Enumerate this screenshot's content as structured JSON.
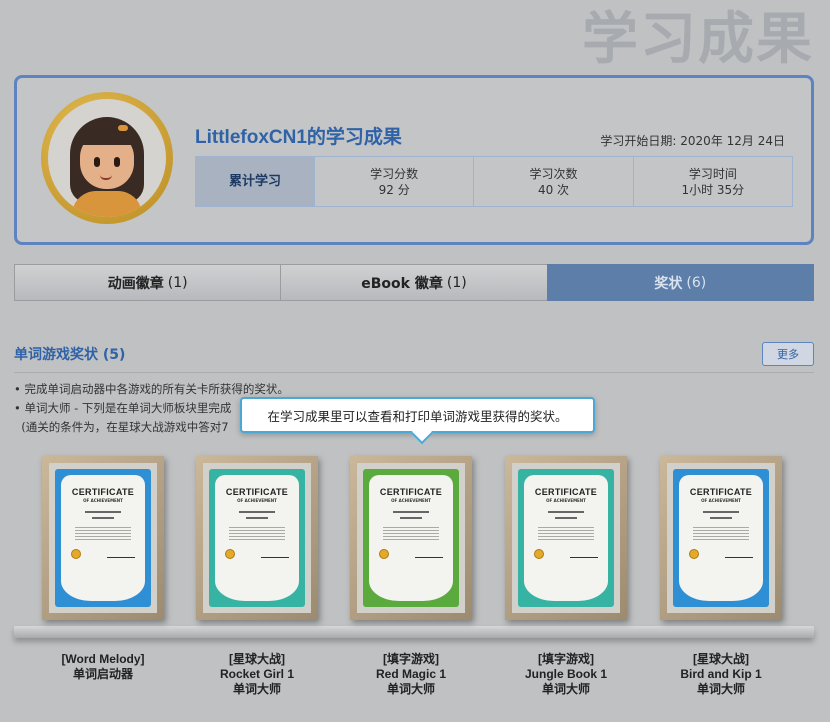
{
  "page_title": "学习成果",
  "profile": {
    "username": "LittlefoxCN1的学习成果",
    "start_date": "学习开始日期: 2020年 12月 24日",
    "stats": {
      "cumulative_label": "累计学习",
      "items": [
        {
          "label": "学习分数",
          "value": "92 分"
        },
        {
          "label": "学习次数",
          "value": "40 次"
        },
        {
          "label": "学习时间",
          "value": "1小时 35分"
        }
      ]
    }
  },
  "tabs": [
    {
      "label": "动画徽章",
      "count": "(1)",
      "active": false
    },
    {
      "label": "eBook 徽章",
      "count": "(1)",
      "active": false
    },
    {
      "label": "奖状",
      "count": "(6)",
      "active": true
    }
  ],
  "section": {
    "title": "单词游戏奖状 (5)",
    "more_label": "更多",
    "notes": [
      "• 完成单词启动器中各游戏的所有关卡所获得的奖状。",
      "• 单词大师 - 下列是在单词大师板块里完成",
      "  (通关的条件为，在星球大战游戏中答对7"
    ]
  },
  "tooltip": "在学习成果里可以查看和打印单词游戏里获得的奖状。",
  "certificate_text": {
    "title": "CERTIFICATE",
    "subtitle": "OF ACHIEVEMENT"
  },
  "awards": [
    {
      "game": "[Word Melody]",
      "book": "",
      "type": "单词启动器",
      "color": "blue"
    },
    {
      "game": "[星球大战]",
      "book": "Rocket Girl 1",
      "type": "单词大师",
      "color": "teal"
    },
    {
      "game": "[填字游戏]",
      "book": "Red Magic 1",
      "type": "单词大师",
      "color": "green"
    },
    {
      "game": "[填字游戏]",
      "book": "Jungle Book 1",
      "type": "单词大师",
      "color": "teal"
    },
    {
      "game": "[星球大战]",
      "book": "Bird and Kip 1",
      "type": "单词大师",
      "color": "blue"
    }
  ]
}
